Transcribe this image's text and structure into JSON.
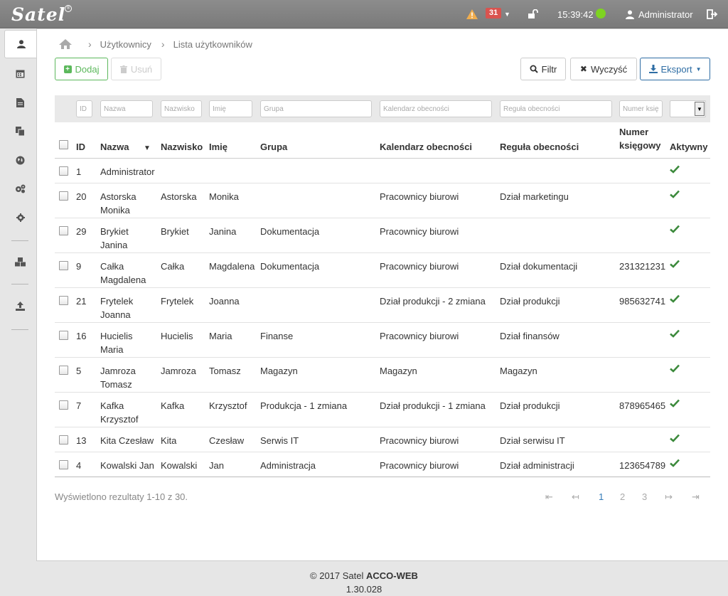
{
  "app": {
    "logo": "Satel",
    "logo_badge": "®",
    "alarm_count": "31",
    "clock": "15:39:42",
    "user": "Administrator"
  },
  "breadcrumb": {
    "item1": "Użytkownicy",
    "item2": "Lista użytkowników"
  },
  "toolbar": {
    "add": "Dodaj",
    "delete": "Usuń",
    "filter": "Filtr",
    "clear": "Wyczyść",
    "export": "Eksport"
  },
  "filters": {
    "id": "ID",
    "name": "Nazwa",
    "surname": "Nazwisko",
    "firstname": "Imię",
    "group": "Grupa",
    "calendar": "Kalendarz obecności",
    "rule": "Reguła obecności",
    "number": "Numer księ"
  },
  "columns": {
    "id": "ID",
    "name": "Nazwa",
    "surname": "Nazwisko",
    "firstname": "Imię",
    "group": "Grupa",
    "calendar": "Kalendarz obecności",
    "rule": "Reguła obecności",
    "number_line1": "Numer",
    "number_line2": "księgowy",
    "active": "Aktywny"
  },
  "rows": [
    {
      "id": "1",
      "name1": "Administrator",
      "name2": "",
      "surname": "",
      "firstname": "",
      "group": "",
      "calendar": "",
      "rule": "",
      "number": "",
      "active": true
    },
    {
      "id": "20",
      "name1": "Astorska",
      "name2": "Monika",
      "surname": "Astorska",
      "firstname": "Monika",
      "group": "",
      "calendar": "Pracownicy biurowi",
      "rule": "Dział marketingu",
      "number": "",
      "active": true
    },
    {
      "id": "29",
      "name1": "Brykiet",
      "name2": "Janina",
      "surname": "Brykiet",
      "firstname": "Janina",
      "group": "Dokumentacja",
      "calendar": "Pracownicy biurowi",
      "rule": "",
      "number": "",
      "active": true
    },
    {
      "id": "9",
      "name1": "Całka",
      "name2": "Magdalena",
      "surname": "Całka",
      "firstname": "Magdalena",
      "group": "Dokumentacja",
      "calendar": "Pracownicy biurowi",
      "rule": "Dział dokumentacji",
      "number": "231321231",
      "active": true
    },
    {
      "id": "21",
      "name1": "Frytelek",
      "name2": "Joanna",
      "surname": "Frytelek",
      "firstname": "Joanna",
      "group": "",
      "calendar": "Dział produkcji - 2 zmiana",
      "rule": "Dział produkcji",
      "number": "985632741",
      "active": true
    },
    {
      "id": "16",
      "name1": "Hucielis",
      "name2": "Maria",
      "surname": "Hucielis",
      "firstname": "Maria",
      "group": "Finanse",
      "calendar": "Pracownicy biurowi",
      "rule": "Dział finansów",
      "number": "",
      "active": true
    },
    {
      "id": "5",
      "name1": "Jamroza",
      "name2": "Tomasz",
      "surname": "Jamroza",
      "firstname": "Tomasz",
      "group": "Magazyn",
      "calendar": "Magazyn",
      "rule": "Magazyn",
      "number": "",
      "active": true
    },
    {
      "id": "7",
      "name1": "Kafka",
      "name2": "Krzysztof",
      "surname": "Kafka",
      "firstname": "Krzysztof",
      "group": "Produkcja - 1 zmiana",
      "calendar": "Dział produkcji - 1 zmiana",
      "rule": "Dział produkcji",
      "number": "878965465",
      "active": true
    },
    {
      "id": "13",
      "name1": "Kita Czesław",
      "name2": "",
      "surname": "Kita",
      "firstname": "Czesław",
      "group": "Serwis IT",
      "calendar": "Pracownicy biurowi",
      "rule": "Dział serwisu IT",
      "number": "",
      "active": true
    },
    {
      "id": "4",
      "name1": "Kowalski Jan",
      "name2": "",
      "surname": "Kowalski",
      "firstname": "Jan",
      "group": "Administracja",
      "calendar": "Pracownicy biurowi",
      "rule": "Dział administracji",
      "number": "123654789",
      "active": true
    }
  ],
  "results_text": "Wyświetlono rezultaty 1-10 z 30.",
  "pager": {
    "first": "⇤",
    "prev": "↤",
    "pages": [
      "1",
      "2",
      "3"
    ],
    "next": "↦",
    "last": "⇥"
  },
  "footer": {
    "copyright": "© 2017 Satel",
    "product": "ACCO-WEB",
    "version": "1.30.028"
  },
  "colors": {
    "accent": "#337ab7",
    "success": "#5cb85c",
    "check": "#3c8a3c",
    "badge": "#d9534f",
    "status_ok": "#7ed321"
  }
}
